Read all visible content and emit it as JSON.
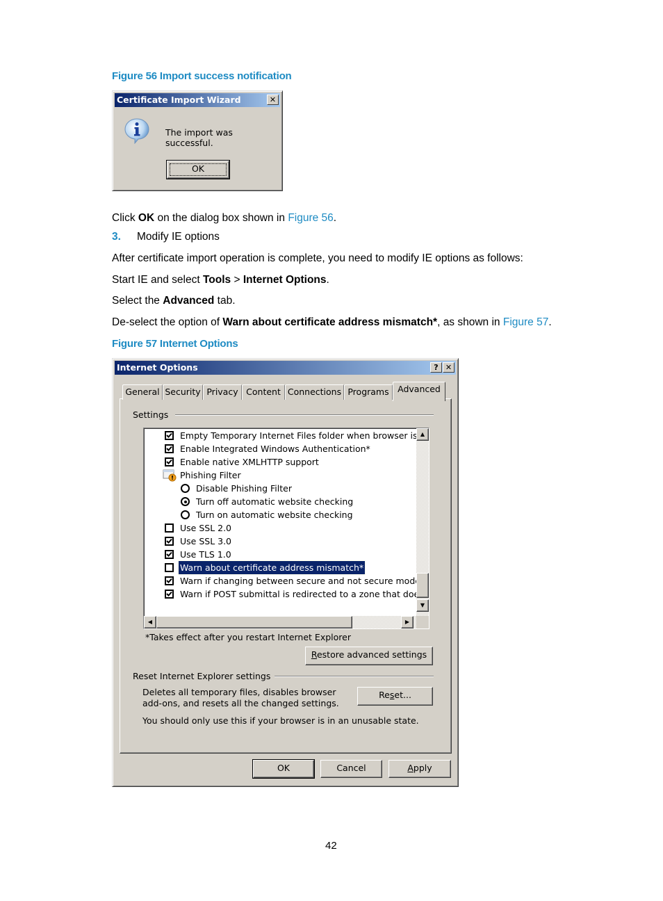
{
  "figure56": {
    "caption": "Figure 56 Import success notification",
    "dialog": {
      "title": "Certificate Import Wizard",
      "close_glyph": "✕",
      "icon": "info-icon",
      "message": "The import was successful.",
      "ok_label": "OK"
    }
  },
  "body": {
    "line1": {
      "pre": "Click ",
      "bold": "OK",
      "mid": " on the dialog box shown in ",
      "link": "Figure 56",
      "post": "."
    },
    "step": {
      "number": "3.",
      "text": "Modify IE options"
    },
    "line3": "After certificate import operation is complete, you need to modify IE options as follows:",
    "line4": {
      "pre": "Start IE and select ",
      "bold1": "Tools",
      "mid": " > ",
      "bold2": "Internet Options",
      "post": "."
    },
    "line5": {
      "pre": "Select the ",
      "bold": "Advanced",
      "post": " tab."
    },
    "line6": {
      "pre": "De-select the option of ",
      "bold": "Warn about certificate address mismatch*",
      "mid": ", as shown in ",
      "link": "Figure 57",
      "post": "."
    }
  },
  "figure57": {
    "caption": "Figure 57 Internet Options",
    "dialog": {
      "title": "Internet Options",
      "help_glyph": "?",
      "close_glyph": "✕",
      "tabs": [
        {
          "label": "General",
          "active": false
        },
        {
          "label": "Security",
          "active": false
        },
        {
          "label": "Privacy",
          "active": false
        },
        {
          "label": "Content",
          "active": false
        },
        {
          "label": "Connections",
          "active": false
        },
        {
          "label": "Programs",
          "active": false
        },
        {
          "label": "Advanced",
          "active": true
        }
      ],
      "settings_label": "Settings",
      "settings_items": [
        {
          "type": "checkbox",
          "label": "Empty Temporary Internet Files folder when browser is clo",
          "checked": true
        },
        {
          "type": "checkbox",
          "label": "Enable Integrated Windows Authentication*",
          "checked": true
        },
        {
          "type": "checkbox",
          "label": "Enable native XMLHTTP support",
          "checked": true
        },
        {
          "type": "group",
          "label": "Phishing Filter",
          "icon": "phishing-filter-icon"
        },
        {
          "type": "radio",
          "label": "Disable Phishing Filter",
          "checked": false
        },
        {
          "type": "radio",
          "label": "Turn off automatic website checking",
          "checked": true
        },
        {
          "type": "radio",
          "label": "Turn on automatic website checking",
          "checked": false
        },
        {
          "type": "checkbox",
          "label": "Use SSL 2.0",
          "checked": false
        },
        {
          "type": "checkbox",
          "label": "Use SSL 3.0",
          "checked": true
        },
        {
          "type": "checkbox",
          "label": "Use TLS 1.0",
          "checked": true
        },
        {
          "type": "checkbox",
          "label": "Warn about certificate address mismatch*",
          "checked": false,
          "selected": true
        },
        {
          "type": "checkbox",
          "label": "Warn if changing between secure and not secure mode",
          "checked": true
        },
        {
          "type": "checkbox",
          "label": "Warn if POST submittal is redirected to a zone that does n",
          "checked": true
        }
      ],
      "restart_note": "*Takes effect after you restart Internet Explorer",
      "restore_button": {
        "accel": "R",
        "rest": "estore advanced settings"
      },
      "reset_group_label": "Reset Internet Explorer settings",
      "reset_desc_line1": "Deletes all temporary files, disables browser",
      "reset_desc_line2": "add-ons, and resets all the changed settings.",
      "reset_button": {
        "pre": "Re",
        "accel": "s",
        "rest": "et..."
      },
      "reset_warning": "You should only use this if your browser is in an unusable state.",
      "ok_label": "OK",
      "cancel_label": "Cancel",
      "apply_button": {
        "accel": "A",
        "rest": "pply"
      }
    }
  },
  "page_number": "42",
  "colors": {
    "accent": "#1e8bc3",
    "title_start": "#0a246a",
    "title_end": "#a6caf0",
    "dialog_bg": "#d4d0c8",
    "selection": "#0a246a"
  }
}
